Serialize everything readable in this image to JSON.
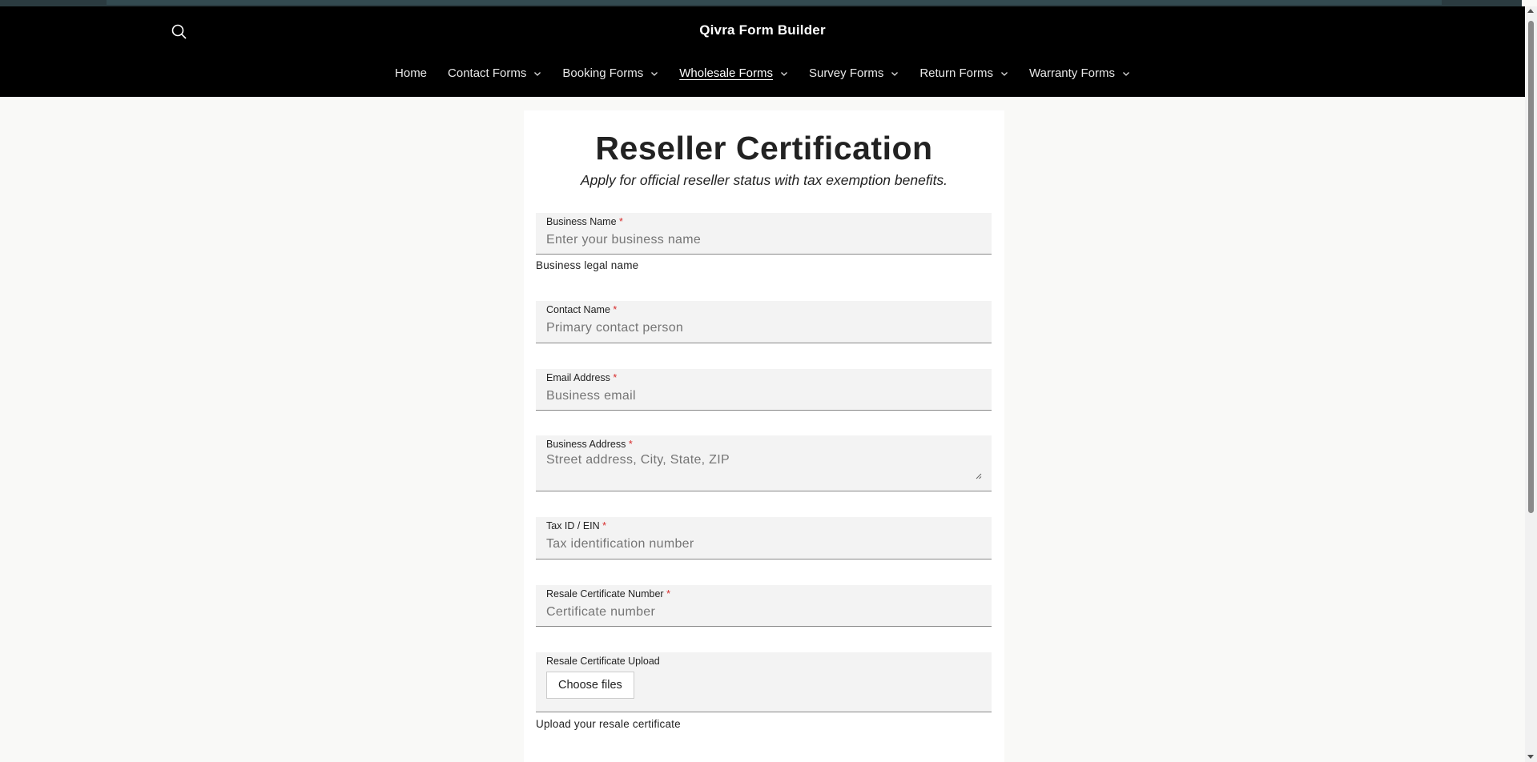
{
  "header": {
    "title": "Qivra Form Builder",
    "search_icon": "search-icon",
    "nav": [
      {
        "label": "Home",
        "dropdown": false,
        "active": false
      },
      {
        "label": "Contact Forms",
        "dropdown": true,
        "active": false
      },
      {
        "label": "Booking Forms",
        "dropdown": true,
        "active": false
      },
      {
        "label": "Wholesale Forms",
        "dropdown": true,
        "active": true
      },
      {
        "label": "Survey Forms",
        "dropdown": true,
        "active": false
      },
      {
        "label": "Return Forms",
        "dropdown": true,
        "active": false
      },
      {
        "label": "Warranty Forms",
        "dropdown": true,
        "active": false
      }
    ]
  },
  "form": {
    "title": "Reseller Certification",
    "subtitle": "Apply for official reseller status with tax exemption benefits.",
    "required_marker": "*",
    "fields": {
      "business_name": {
        "label": "Business Name",
        "placeholder": "Enter your business name",
        "help": "Business legal name"
      },
      "contact_name": {
        "label": "Contact Name",
        "placeholder": "Primary contact person"
      },
      "email": {
        "label": "Email Address",
        "placeholder": "Business email"
      },
      "address": {
        "label": "Business Address",
        "placeholder": "Street address, City, State, ZIP"
      },
      "tax_id": {
        "label": "Tax ID / EIN",
        "placeholder": "Tax identification number"
      },
      "resale_number": {
        "label": "Resale Certificate Number",
        "placeholder": "Certificate number"
      },
      "resale_upload": {
        "label": "Resale Certificate Upload",
        "button": "Choose files",
        "help": "Upload your resale certificate"
      }
    }
  },
  "colors": {
    "header_bg": "#000000",
    "page_bg": "#f9f9f7",
    "required": "#d72c2c",
    "field_bg": "#f3f3f3"
  }
}
